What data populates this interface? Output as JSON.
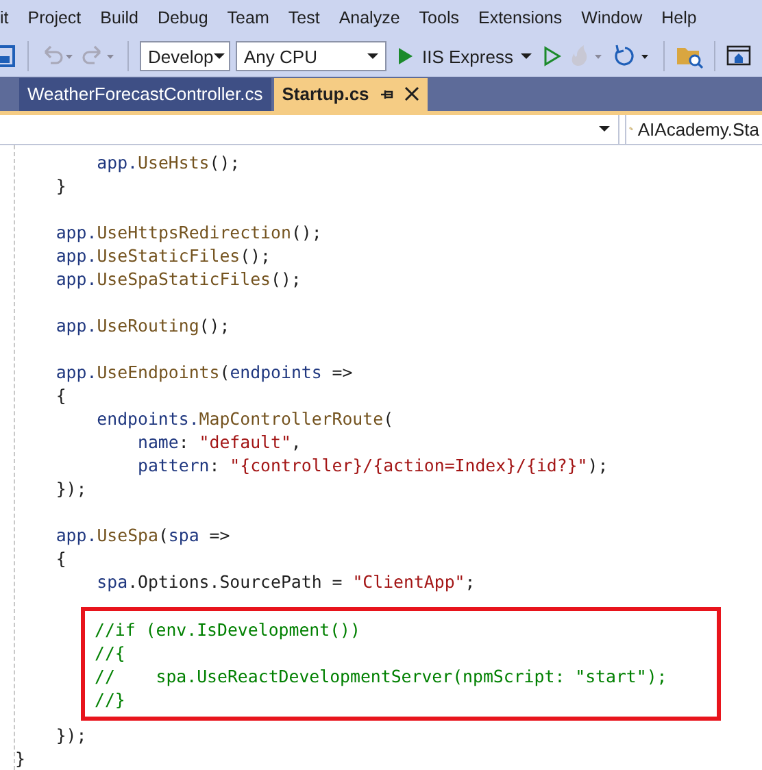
{
  "menu": [
    "it",
    "Project",
    "Build",
    "Debug",
    "Team",
    "Test",
    "Analyze",
    "Tools",
    "Extensions",
    "Window",
    "Help"
  ],
  "toolbar": {
    "configuration": "Develop",
    "platform": "Any CPU",
    "run_target": "IIS Express"
  },
  "tabs": [
    {
      "label": "WeatherForecastController.cs",
      "selected": false
    },
    {
      "label": "Startup.cs",
      "selected": true
    }
  ],
  "nav_bar": {
    "member": "AIAcademy.Sta"
  },
  "code": [
    {
      "kind": "plain",
      "lines": [
        [
          {
            "t": "        app.",
            "kind": "var"
          },
          {
            "t": "UseHsts",
            "kind": "method"
          },
          {
            "t": "();",
            "kind": "plain"
          }
        ],
        [
          {
            "t": "    }",
            "kind": "plain"
          }
        ]
      ]
    },
    {
      "kind": "plain",
      "lines": [
        [
          {
            "t": "    app.",
            "kind": "var"
          },
          {
            "t": "UseHttpsRedirection",
            "kind": "method"
          },
          {
            "t": "();",
            "kind": "plain"
          }
        ],
        [
          {
            "t": "    app.",
            "kind": "var"
          },
          {
            "t": "UseStaticFiles",
            "kind": "method"
          },
          {
            "t": "();",
            "kind": "plain"
          }
        ],
        [
          {
            "t": "    app.",
            "kind": "var"
          },
          {
            "t": "UseSpaStaticFiles",
            "kind": "method"
          },
          {
            "t": "();",
            "kind": "plain"
          }
        ]
      ]
    },
    {
      "kind": "plain",
      "lines": [
        [
          {
            "t": "    app.",
            "kind": "var"
          },
          {
            "t": "UseRouting",
            "kind": "method"
          },
          {
            "t": "();",
            "kind": "plain"
          }
        ]
      ]
    },
    {
      "kind": "plain",
      "lines": [
        [
          {
            "t": "    app.",
            "kind": "var"
          },
          {
            "t": "UseEndpoints",
            "kind": "method"
          },
          {
            "t": "(",
            "kind": "plain"
          },
          {
            "t": "endpoints",
            "kind": "var"
          },
          {
            "t": " =>",
            "kind": "plain"
          }
        ],
        [
          {
            "t": "    {",
            "kind": "plain"
          }
        ],
        [
          {
            "t": "        endpoints.",
            "kind": "var"
          },
          {
            "t": "MapControllerRoute",
            "kind": "method"
          },
          {
            "t": "(",
            "kind": "plain"
          }
        ],
        [
          {
            "t": "            name",
            "kind": "var"
          },
          {
            "t": ": ",
            "kind": "plain"
          },
          {
            "t": "\"default\"",
            "kind": "string"
          },
          {
            "t": ",",
            "kind": "plain"
          }
        ],
        [
          {
            "t": "            pattern",
            "kind": "var"
          },
          {
            "t": ": ",
            "kind": "plain"
          },
          {
            "t": "\"{controller}/{action=Index}/{id?}\"",
            "kind": "string"
          },
          {
            "t": ");",
            "kind": "plain"
          }
        ],
        [
          {
            "t": "    });",
            "kind": "plain"
          }
        ]
      ]
    },
    {
      "kind": "plain",
      "lines": [
        [
          {
            "t": "    app.",
            "kind": "var"
          },
          {
            "t": "UseSpa",
            "kind": "method"
          },
          {
            "t": "(",
            "kind": "plain"
          },
          {
            "t": "spa",
            "kind": "var"
          },
          {
            "t": " =>",
            "kind": "plain"
          }
        ],
        [
          {
            "t": "    {",
            "kind": "plain"
          }
        ],
        [
          {
            "t": "        spa",
            "kind": "var"
          },
          {
            "t": ".Options.SourcePath = ",
            "kind": "plain"
          },
          {
            "t": "\"ClientApp\"",
            "kind": "string"
          },
          {
            "t": ";",
            "kind": "plain"
          }
        ]
      ]
    },
    {
      "kind": "highlighted",
      "lines": [
        [
          {
            "t": "//if (env.IsDevelopment())",
            "kind": "comment"
          }
        ],
        [
          {
            "t": "//{",
            "kind": "comment"
          }
        ],
        [
          {
            "t": "//    spa.UseReactDevelopmentServer(npmScript: \"start\");",
            "kind": "comment"
          }
        ],
        [
          {
            "t": "//}",
            "kind": "comment"
          }
        ]
      ]
    },
    {
      "kind": "plain",
      "lines": [
        [
          {
            "t": "    });",
            "kind": "plain"
          }
        ],
        [
          {
            "t": "}",
            "kind": "plain"
          }
        ]
      ]
    }
  ]
}
